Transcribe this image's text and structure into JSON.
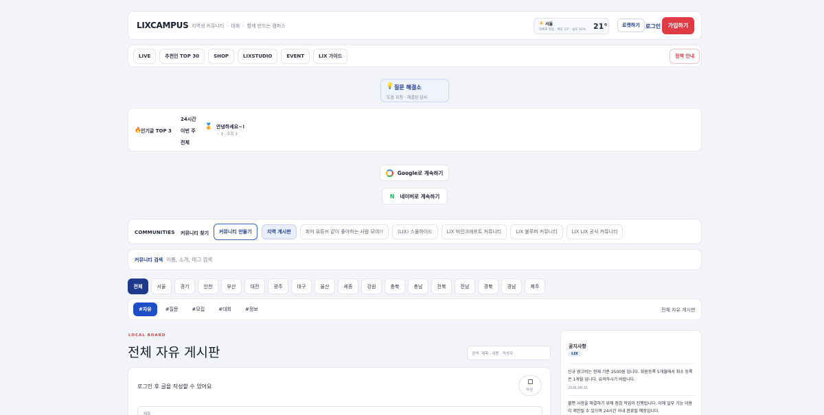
{
  "header": {
    "logo": "LIXCAMPUS",
    "taglines": [
      "지역생 커뮤니티",
      "대화",
      "함께 만드는 캠퍼스"
    ],
    "weather": {
      "city": "서울",
      "desc": "대체로 맑음 · 체감 23° · 습도 42%",
      "temp": "21°"
    },
    "btn_mode": "로켓하기",
    "btn_login": "로그인",
    "btn_signup": "가입하기"
  },
  "nav": {
    "items": [
      "LIVE",
      "추천인 TOP 30",
      "SHOP",
      "LIXSTUDIO",
      "EVENT",
      "LIX 가이드"
    ],
    "policy": "정책 안내"
  },
  "qa": {
    "title": "질문 해결소",
    "sub": "도움 요청 · 해결된 답사"
  },
  "popular": {
    "label": "인기글 TOP 3",
    "tabs": [
      "24시간",
      "이번 주",
      "전체"
    ],
    "post_title": "안녕하세요~!",
    "post_meta": "♡ 3 · 조회 3"
  },
  "auth": {
    "google": "Google로 계속하기",
    "naver": "네이버로 계속하기"
  },
  "communities": {
    "label": "COMMUNITIES",
    "find": "커뮤니티 찾기",
    "create": "커뮤니티 만들기",
    "items": [
      "지역 게시판",
      "취미 유튜브 같이 좋아하는 사람 모여!!",
      "(LIX) 스물하이드",
      "LIX 마인크래프트 커뮤니티",
      "LIX 블루퍼 커뮤니티",
      "LIX LIX 공식 커뮤니티"
    ]
  },
  "search": {
    "label": "커뮤니티 검색",
    "placeholder": "이름, 소개, 태그 검색"
  },
  "regions": [
    "전체",
    "서울",
    "경기",
    "인천",
    "부산",
    "대전",
    "광주",
    "대구",
    "울산",
    "세종",
    "강원",
    "충북",
    "충남",
    "전북",
    "전남",
    "경북",
    "경남",
    "제주"
  ],
  "tags": {
    "items": [
      "#자유",
      "#질문",
      "#모집",
      "#대회",
      "#정보"
    ],
    "right": "전체 자유 게시판"
  },
  "board": {
    "eyebrow": "LOCAL BOARD",
    "title": "전체 자유 게시판",
    "search_label": "검색",
    "search_placeholder": "제목 · 내용 · 작성자",
    "login_prompt": "로그인 후 글을 작성할 수 있어요",
    "write": "작성",
    "input_hint": "제목"
  },
  "notice": {
    "title": "공지사항",
    "badge": "LIX",
    "items": [
      {
        "text": "신규 광고비는 현재 기준 2500원 입니다. 회원등록 5개월에서 최소 등록은 1개월 입니다. 유의하시기 바랍니다.",
        "date": "2026-08-31"
      },
      {
        "text": "불편 사항을 해결하기 위해 점검 작업이 진행됩니다. 이에 일부 기능 이용이 제한될 수 있으며 24시간 이내 완료될 예정입니다."
      }
    ]
  },
  "colors": {
    "accent": "#1f3a8a",
    "danger": "#e03a45",
    "eyebrow": "#d23c44"
  }
}
